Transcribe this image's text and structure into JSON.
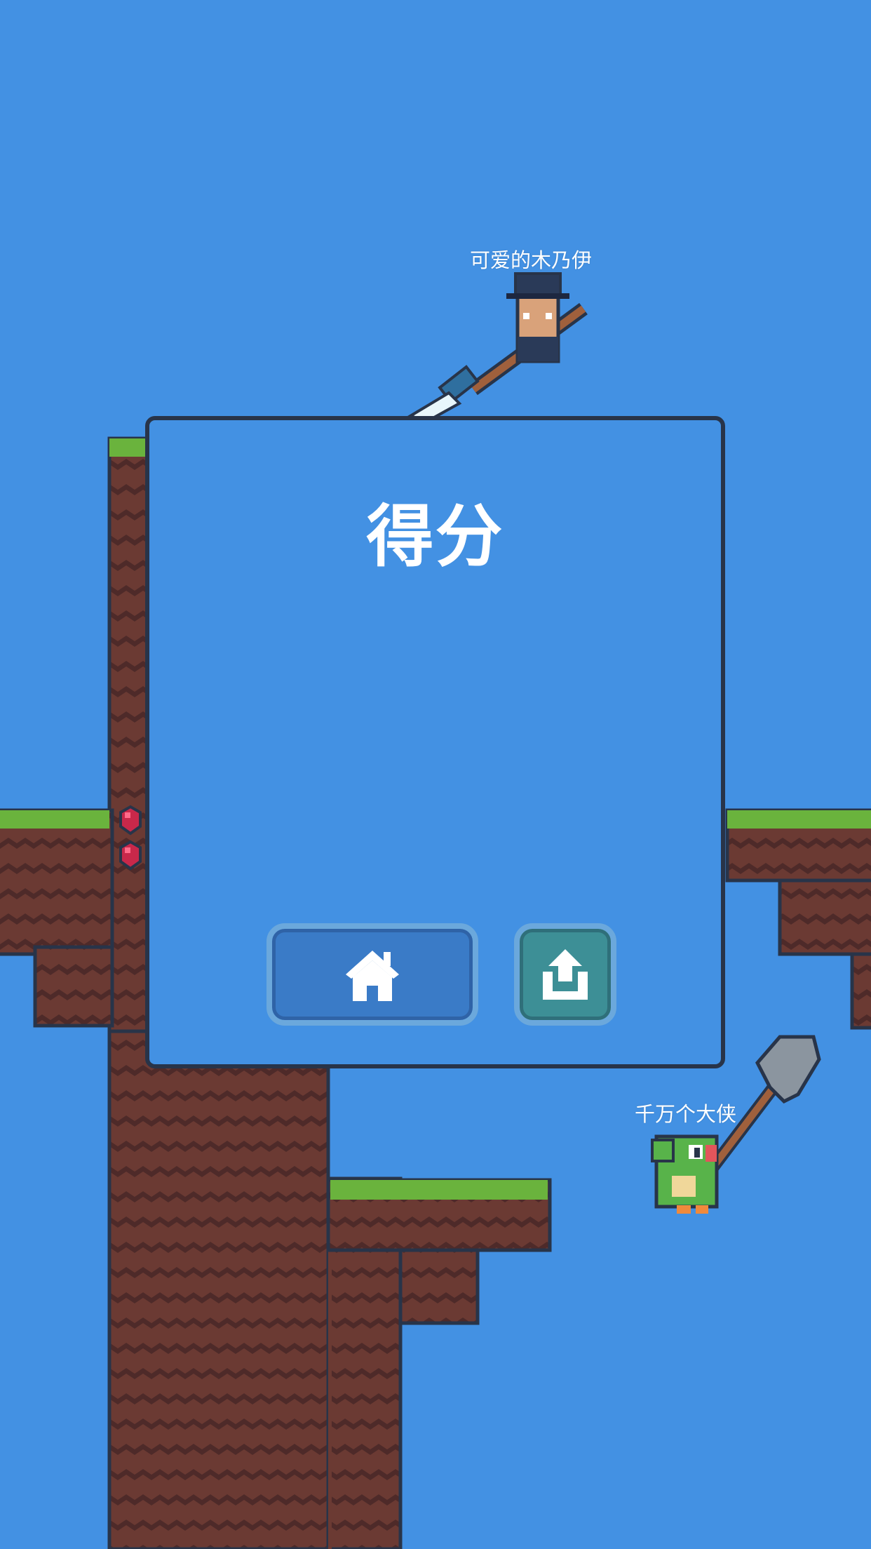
{
  "players": {
    "top_player_name": "可爱的木乃伊",
    "bottom_player_name": "千万个大侠"
  },
  "panel": {
    "title": "得分"
  },
  "buttons": {
    "home_icon": "home-icon",
    "share_icon": "share-icon"
  },
  "colors": {
    "sky": "#4391e3",
    "dirt": "#6b3a33",
    "dirt_dark": "#4e2a29",
    "grass": "#6ab33d",
    "outline": "#283449",
    "share_button": "#3d8f96",
    "home_button": "#3a7bc7"
  }
}
